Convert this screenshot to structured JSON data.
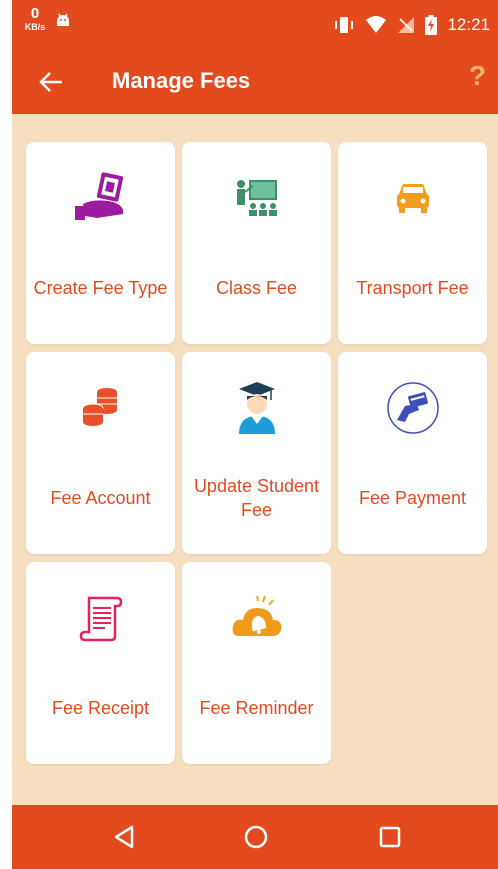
{
  "status_bar": {
    "net_speed": "0",
    "net_unit": "KB/s",
    "time": "12:21",
    "icons": [
      "android-icon",
      "vibrate-icon",
      "wifi-icon",
      "no-signal-icon",
      "battery-charging-icon"
    ]
  },
  "app_bar": {
    "title": "Manage Fees",
    "back_icon": "arrow-left-icon",
    "help_icon": "question-mark-icon",
    "help_label": "?"
  },
  "tiles": [
    {
      "label": "Create Fee Type",
      "icon": "money-hand-icon"
    },
    {
      "label": "Class Fee",
      "icon": "classroom-icon"
    },
    {
      "label": "Transport Fee",
      "icon": "car-icon"
    },
    {
      "label": "Fee Account",
      "icon": "coins-icon"
    },
    {
      "label": "Update Student Fee",
      "icon": "graduate-icon"
    },
    {
      "label": "Fee Payment",
      "icon": "card-payment-icon"
    },
    {
      "label": "Fee Receipt",
      "icon": "receipt-icon"
    },
    {
      "label": "Fee Reminder",
      "icon": "bell-cloud-icon"
    }
  ],
  "nav_bar": {
    "buttons": [
      "back-triangle-icon",
      "home-circle-icon",
      "recents-square-icon"
    ]
  },
  "colors": {
    "primary": "#e34b1e",
    "background": "#f5dfbf",
    "tile": "#ffffff",
    "help": "#f6b26b"
  }
}
